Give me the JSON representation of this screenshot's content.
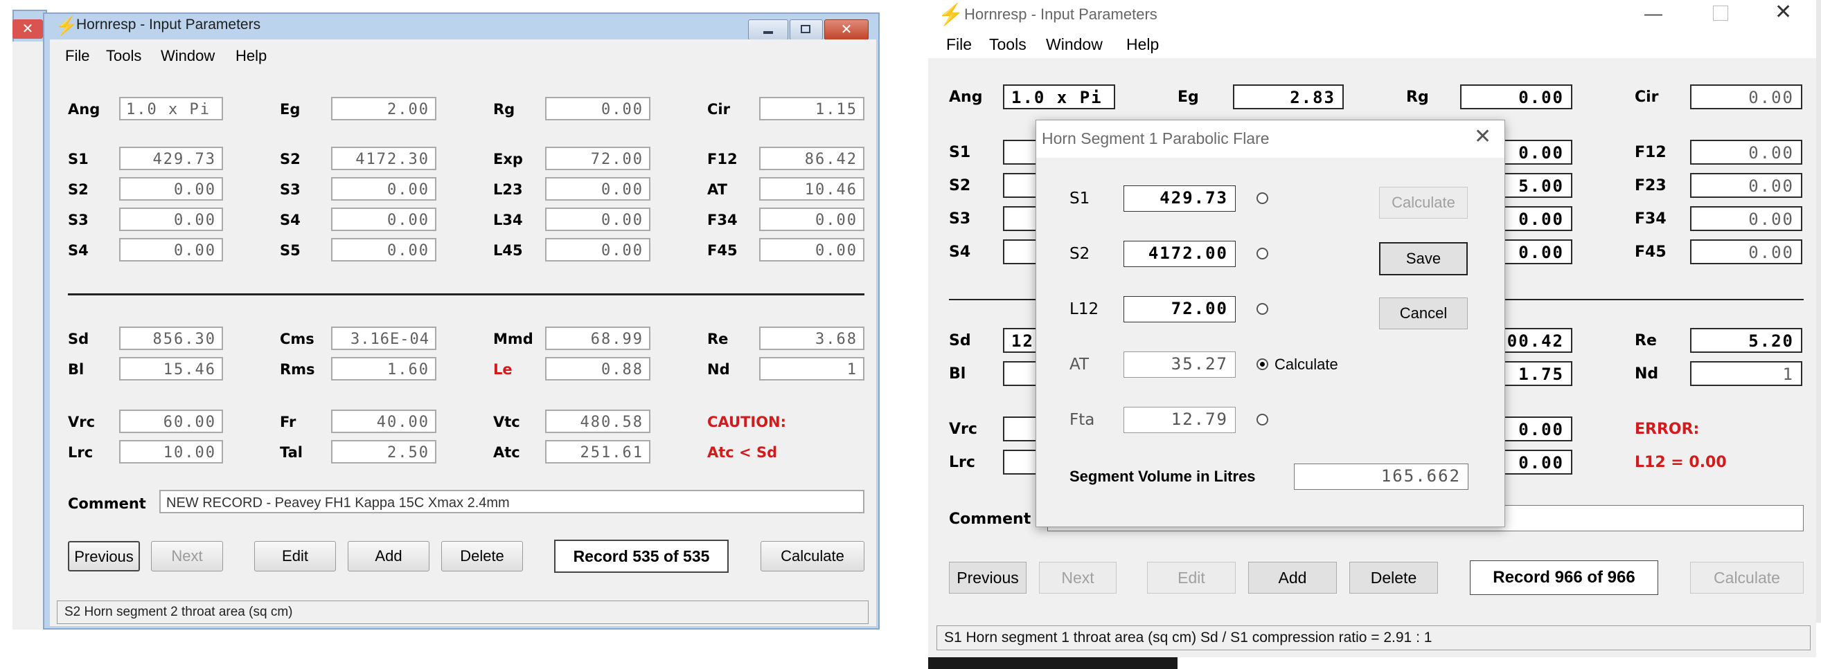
{
  "left": {
    "title": "Hornresp - Input Parameters",
    "menu": [
      "File",
      "Tools",
      "Window",
      "Help"
    ],
    "rows1": [
      {
        "label": "Ang",
        "value": "1.0 x Pi"
      },
      {
        "label": "Eg",
        "value": "2.00"
      },
      {
        "label": "Rg",
        "value": "0.00"
      },
      {
        "label": "Cir",
        "value": "1.15"
      }
    ],
    "grid": [
      [
        {
          "label": "S1",
          "value": "429.73"
        },
        {
          "label": "S2",
          "value": "4172.30"
        },
        {
          "label": "Exp",
          "value": "72.00"
        },
        {
          "label": "F12",
          "value": "86.42"
        }
      ],
      [
        {
          "label": "S2",
          "value": "0.00"
        },
        {
          "label": "S3",
          "value": "0.00"
        },
        {
          "label": "L23",
          "value": "0.00"
        },
        {
          "label": "AT",
          "value": "10.46"
        }
      ],
      [
        {
          "label": "S3",
          "value": "0.00"
        },
        {
          "label": "S4",
          "value": "0.00"
        },
        {
          "label": "L34",
          "value": "0.00"
        },
        {
          "label": "F34",
          "value": "0.00"
        }
      ],
      [
        {
          "label": "S4",
          "value": "0.00"
        },
        {
          "label": "S5",
          "value": "0.00"
        },
        {
          "label": "L45",
          "value": "0.00"
        },
        {
          "label": "F45",
          "value": "0.00"
        }
      ]
    ],
    "driver": [
      [
        {
          "label": "Sd",
          "value": "856.30"
        },
        {
          "label": "Cms",
          "value": "3.16E-04"
        },
        {
          "label": "Mmd",
          "value": "68.99"
        },
        {
          "label": "Re",
          "value": "3.68"
        }
      ],
      [
        {
          "label": "Bl",
          "value": "15.46"
        },
        {
          "label": "Rms",
          "value": "1.60"
        },
        {
          "label": "Le",
          "value": "0.88"
        },
        {
          "label": "Nd",
          "value": "1"
        }
      ]
    ],
    "chamber": [
      [
        {
          "label": "Vrc",
          "value": "60.00"
        },
        {
          "label": "Fr",
          "value": "40.00"
        },
        {
          "label": "Vtc",
          "value": "480.58"
        }
      ],
      [
        {
          "label": "Lrc",
          "value": "10.00"
        },
        {
          "label": "Tal",
          "value": "2.50"
        },
        {
          "label": "Atc",
          "value": "251.61"
        }
      ]
    ],
    "warning_title": "CAUTION:",
    "warning_text": "Atc < Sd",
    "comment_label": "Comment",
    "comment_value": "NEW RECORD - Peavey FH1  Kappa 15C  Xmax 2.4mm",
    "buttons": {
      "previous": "Previous",
      "next": "Next",
      "edit": "Edit",
      "add": "Add",
      "delete": "Delete",
      "calculate": "Calculate"
    },
    "record": "Record 535 of 535",
    "status": "S2   Horn segment 2 throat area  (sq cm)"
  },
  "right": {
    "title": "Hornresp - Input Parameters",
    "menu": [
      "File",
      "Tools",
      "Window",
      "Help"
    ],
    "rows1": [
      {
        "label": "Ang",
        "value": "1.0 x Pi"
      },
      {
        "label": "Eg",
        "value": "2.83"
      },
      {
        "label": "Rg",
        "value": "0.00"
      },
      {
        "label": "Cir",
        "value": "0.00"
      }
    ],
    "left_labels": [
      "S1",
      "S2",
      "S3",
      "S4"
    ],
    "mid_values": [
      "0.00",
      "5.00",
      "0.00",
      "0.00"
    ],
    "right_col": [
      {
        "label": "F12",
        "value": "0.00"
      },
      {
        "label": "F23",
        "value": "0.00"
      },
      {
        "label": "F34",
        "value": "0.00"
      },
      {
        "label": "F45",
        "value": "0.00"
      }
    ],
    "driver_left": [
      {
        "label": "Sd",
        "value": "12"
      },
      {
        "label": "Bl",
        "value": ""
      }
    ],
    "driver_mid": [
      "00.42",
      "1.75"
    ],
    "driver_right": [
      {
        "label": "Re",
        "value": "5.20"
      },
      {
        "label": "Nd",
        "value": "1"
      }
    ],
    "chamber_left": [
      "Vrc",
      "Lrc"
    ],
    "chamber_mid": [
      "0.00",
      "0.00"
    ],
    "warning_title": "ERROR:",
    "warning_text": "L12 = 0.00",
    "comment_label": "Comment",
    "buttons": {
      "previous": "Previous",
      "next": "Next",
      "edit": "Edit",
      "add": "Add",
      "delete": "Delete",
      "calculate": "Calculate"
    },
    "record": "Record 966 of 966",
    "status": "S1   Horn segment 1 throat area  (sq cm)   Sd / S1 compression ratio = 2.91 : 1",
    "dialog": {
      "title": "Horn Segment 1 Parabolic Flare",
      "rows": [
        {
          "label": "S1",
          "value": "429.73",
          "selected": false
        },
        {
          "label": "S2",
          "value": "4172.00",
          "selected": false
        },
        {
          "label": "L12",
          "value": "72.00",
          "selected": false
        },
        {
          "label": "AT",
          "value": "35.27",
          "selected": true
        },
        {
          "label": "Fta",
          "value": "12.79",
          "selected": false
        }
      ],
      "selected_label": "Calculate",
      "buttons": {
        "calculate": "Calculate",
        "save": "Save",
        "cancel": "Cancel"
      },
      "volume_label": "Segment Volume in Litres",
      "volume_value": "165.662"
    }
  },
  "colors": {
    "warning": "#d21b1b",
    "left_frame": "#bcd3ee",
    "client": "#f0f0f0"
  }
}
